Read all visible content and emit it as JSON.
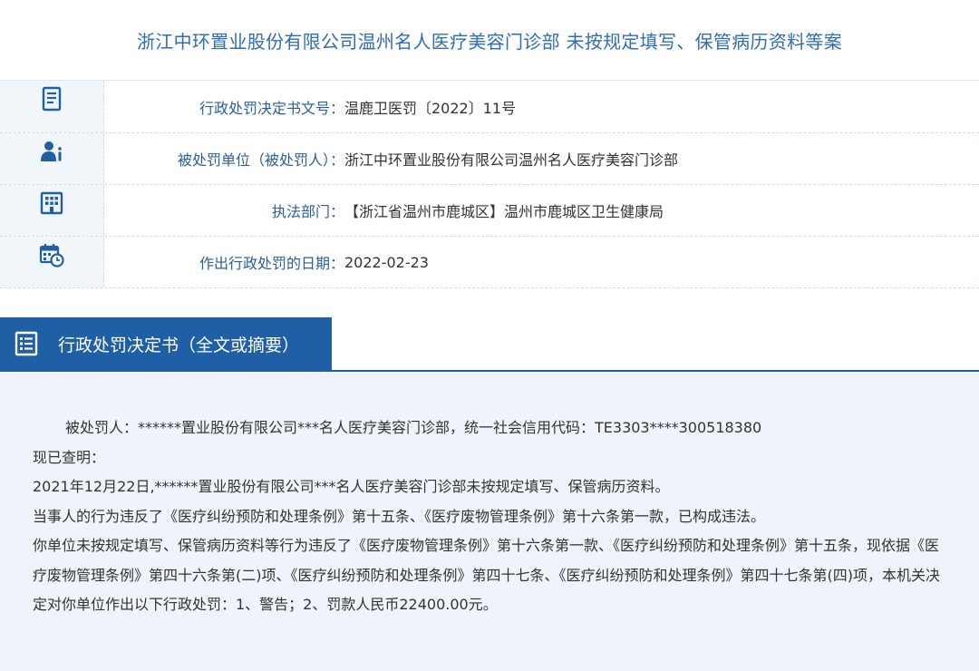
{
  "header": {
    "title": "浙江中环置业股份有限公司温州名人医疗美容门诊部 未按规定填写、保管病历资料等案"
  },
  "info": [
    {
      "icon": "document-icon",
      "label": "行政处罚决定书文号：",
      "value": "温鹿卫医罚〔2022〕11号"
    },
    {
      "icon": "person-info-icon",
      "label": "被处罚单位（被处罚人）：",
      "value": "浙江中环置业股份有限公司温州名人医疗美容门诊部"
    },
    {
      "icon": "building-icon",
      "label": "执法部门：",
      "value": "【浙江省温州市鹿城区】温州市鹿城区卫生健康局"
    },
    {
      "icon": "calendar-clock-icon",
      "label": "作出行政处罚的日期：",
      "value": "2022-02-23"
    }
  ],
  "section": {
    "icon": "document-list-icon",
    "title": "行政处罚决定书（全文或摘要）"
  },
  "content": {
    "lines": [
      "被处罚人：******置业股份有限公司***名人医疗美容门诊部，统一社会信用代码：TE3303****300518380",
      "现已查明：",
      "2021年12月22日,******置业股份有限公司***名人医疗美容门诊部未按规定填写、保管病历资料。",
      "当事人的行为违反了《医疗纠纷预防和处理条例》第十五条、《医疗废物管理条例》第十六条第一款，已构成违法。",
      "你单位未按规定填写、保管病历资料等行为违反了《医疗废物管理条例》第十六条第一款、《医疗纠纷预防和处理条例》第十五条，现依据《医疗废物管理条例》第四十六条第(二)项、《医疗纠纷预防和处理条例》第四十七条、《医疗纠纷预防和处理条例》第四十七条第(四)项，本机关决定对你单位作出以下行政处罚：1、警告；2、罚款人民币22400.00元。"
    ]
  },
  "colors": {
    "accent": "#1f5fa6",
    "title": "#2f6db5",
    "label": "#2a5e9c",
    "icon_bg": "#f1f6fb",
    "content_bg": "#eef4fa"
  }
}
